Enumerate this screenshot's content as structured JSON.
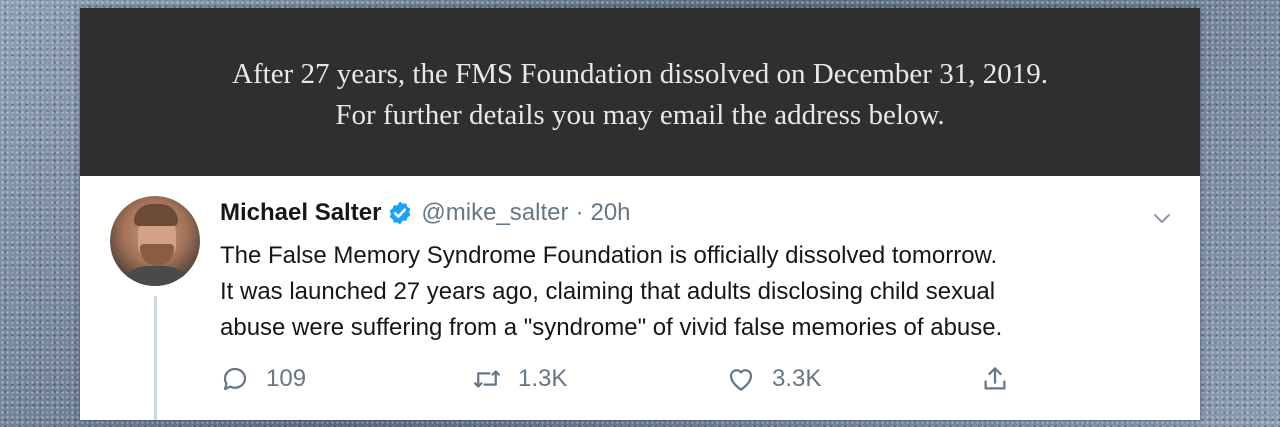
{
  "banner": {
    "line1": "After 27 years, the FMS Foundation dissolved on December 31, 2019.",
    "line2": "For further details you may email the address below."
  },
  "tweet": {
    "display_name": "Michael Salter",
    "handle": "@mike_salter",
    "separator": "·",
    "time": "20h",
    "text_lines": [
      "The False Memory Syndrome Foundation is officially dissolved tomorrow.",
      "It was launched 27 years ago, claiming that adults disclosing child sexual",
      "abuse were suffering from a \"syndrome\" of vivid false memories of abuse."
    ],
    "actions": {
      "replies": "109",
      "retweets": "1.3K",
      "likes": "3.3K"
    },
    "icons": {
      "verified": "verified-badge-icon",
      "more": "chevron-down-icon",
      "reply": "reply-icon",
      "retweet": "retweet-icon",
      "like": "heart-icon",
      "share": "share-icon"
    }
  },
  "colors": {
    "banner_bg": "#2f2f2f",
    "verified_blue": "#1da1f2",
    "muted_text": "#657786"
  }
}
